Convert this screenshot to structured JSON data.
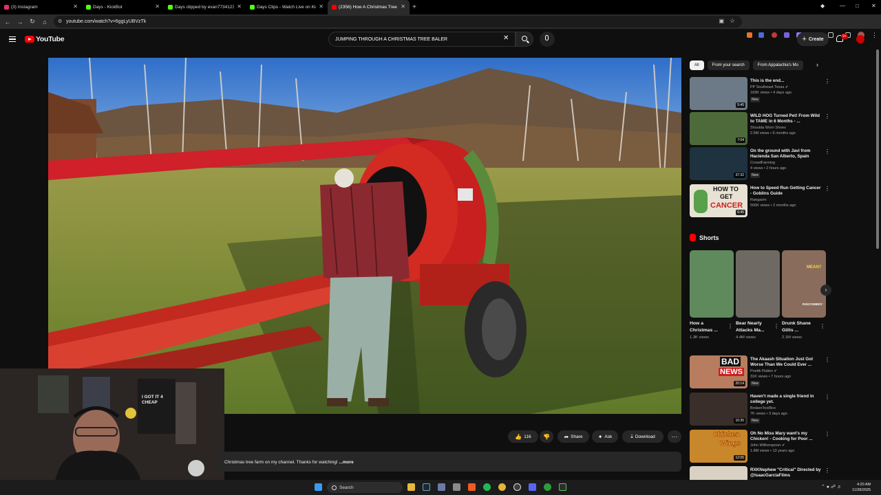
{
  "browser": {
    "tabs": [
      {
        "label": "(3) Instagram",
        "fav_color": "#e1306c",
        "active": false
      },
      {
        "label": "Days - KickBot",
        "fav_color": "#53fc18",
        "active": false
      },
      {
        "label": "Days clipped by evan7734123",
        "fav_color": "#53fc18",
        "active": false
      },
      {
        "label": "Days Clips - Watch Live on Kick",
        "fav_color": "#53fc18",
        "active": false
      },
      {
        "label": "(2356) How A Christmas Tree B",
        "fav_color": "#ff0000",
        "active": true
      }
    ],
    "url": "youtube.com/watch?v=6ggLyUBVzTk"
  },
  "youtube": {
    "logo_text": "YouTube",
    "search_query": "JUMPING THROUGH A CHRISTMAS TREE BALER",
    "create_label": "Create",
    "notification_count": "9+"
  },
  "video": {
    "like_count": "116",
    "share_label": "Share",
    "ask_label": "Ask",
    "download_label": "Download",
    "description": "Christmas tree farm on my channel. Thanks for watching!",
    "more_label": "...more"
  },
  "sidebar": {
    "chips": [
      "All",
      "From your search",
      "From Appalachia's Mo"
    ],
    "recommendations_top": [
      {
        "title": "This is the end...",
        "channel": "PP Southeast Texas",
        "verified": true,
        "meta": "183K views • 4 days ago",
        "badge": "New",
        "duration": "5:40",
        "thumb_color": "#6b7a86"
      },
      {
        "title": "WILD HOG Turned Pet! From Wild to TAME in 6 Months - ...",
        "channel": "Shoulda Worn Shoes",
        "verified": false,
        "meta": "2.6M views • 6 months ago",
        "badge": "",
        "duration": "7:04",
        "thumb_color": "#4d6b3a"
      },
      {
        "title": "On the ground with Javi from Hacienda San Alberto, Spain",
        "channel": "CrowdFarming",
        "verified": false,
        "meta": "4 views • 2 hours ago",
        "badge": "New",
        "duration": "37:32",
        "thumb_color": "#1e3240"
      },
      {
        "title": "How to Speed Run Getting Cancer - Goblins Guide",
        "channel": "Raegasm",
        "verified": false,
        "meta": "506K views • 2 months ago",
        "badge": "",
        "duration": "6:45",
        "thumb_color": "#e8e2d4"
      }
    ],
    "shorts_heading": "Shorts",
    "shorts": [
      {
        "title": "How a Christmas ...",
        "views": "1.3K views",
        "thumb_color": "#5e8a5c"
      },
      {
        "title": "Bear Nearly Attacks Ma...",
        "views": "4.4M views",
        "thumb_color": "#6e6a63"
      },
      {
        "title": "Drunk Shane Gillis ...",
        "views": "2.1M views",
        "thumb_color": "#8a6c5c"
      }
    ],
    "recommendations_bottom": [
      {
        "title": "The Akaash Situation Just Got Worse Than We Could Ever ...",
        "channel": "Poetik Flakko",
        "verified": true,
        "meta": "31K views • 7 hours ago",
        "badge": "New",
        "duration": "20:14",
        "thumb_color": "#b77d5e"
      },
      {
        "title": "Haven't made a single friend in college yet.",
        "channel": "BrokenToolBox",
        "verified": false,
        "meta": "7K views • 3 days ago",
        "badge": "New",
        "duration": "10:35",
        "thumb_color": "#3a2e2a"
      },
      {
        "title": "Oh No Miss Mary want's my Chicken! - Cooking for Poor ...",
        "channel": "John Witherspoon",
        "verified": true,
        "meta": "1.8M views • 13 years ago",
        "badge": "",
        "duration": "12:05",
        "thumb_color": "#c8872a"
      },
      {
        "title": "RXKNephew \"Critical\" Directed by @IsaacGarciaFilms",
        "channel": "",
        "verified": false,
        "meta": "",
        "badge": "",
        "duration": "",
        "thumb_color": "#d9d2c4"
      }
    ],
    "thumb_text": {
      "cancer_line1": "HOW TO",
      "cancer_line2": "GET",
      "cancer_line3": "CANCER",
      "bad": "BAD",
      "news": "NEWS",
      "chicken": "Chicken",
      "wings": "Wings",
      "shorts_mean": "MEAN?",
      "shorts_brand": "RXKCOMEDY"
    }
  },
  "webcam": {
    "poster_text": "I GOT IT 4 CHEAP"
  },
  "taskbar": {
    "search_label": "Search",
    "time": "4:20 AM",
    "date": "11/28/2025"
  }
}
